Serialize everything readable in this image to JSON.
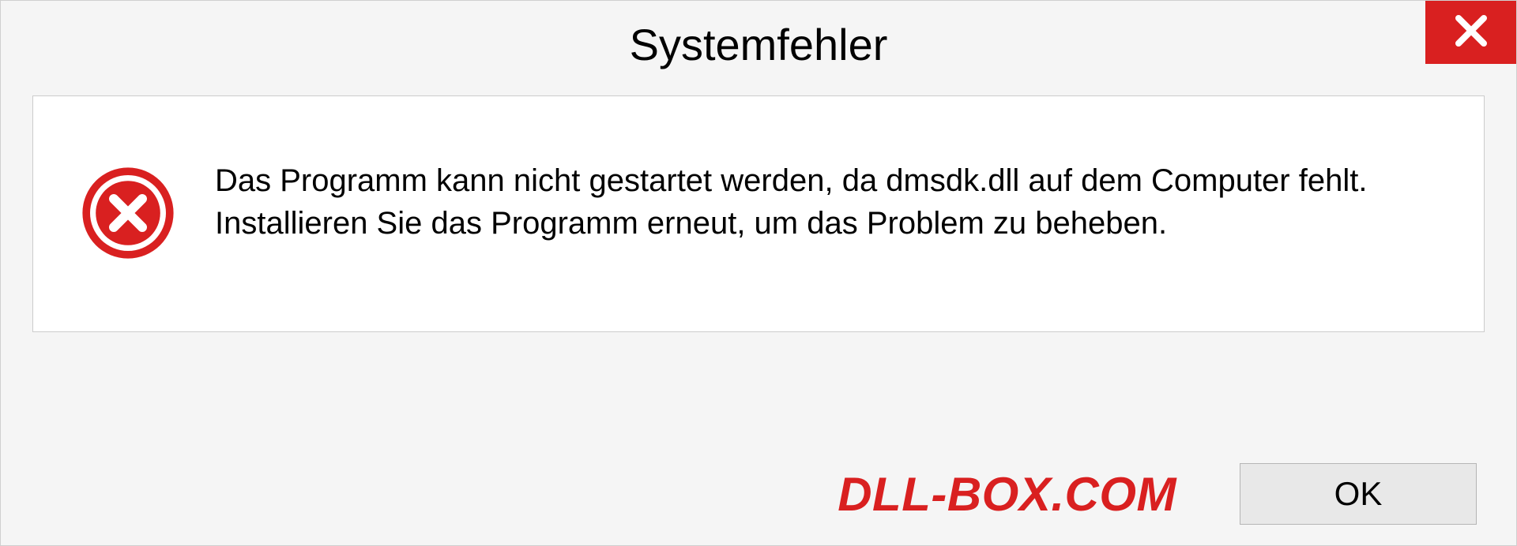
{
  "dialog": {
    "title": "Systemfehler",
    "message": "Das Programm kann nicht gestartet werden, da dmsdk.dll auf dem Computer fehlt. Installieren Sie das Programm erneut, um das Problem zu beheben.",
    "ok_label": "OK"
  },
  "watermark": "DLL-BOX.COM",
  "colors": {
    "close_bg": "#d92020",
    "watermark": "#d92020"
  }
}
